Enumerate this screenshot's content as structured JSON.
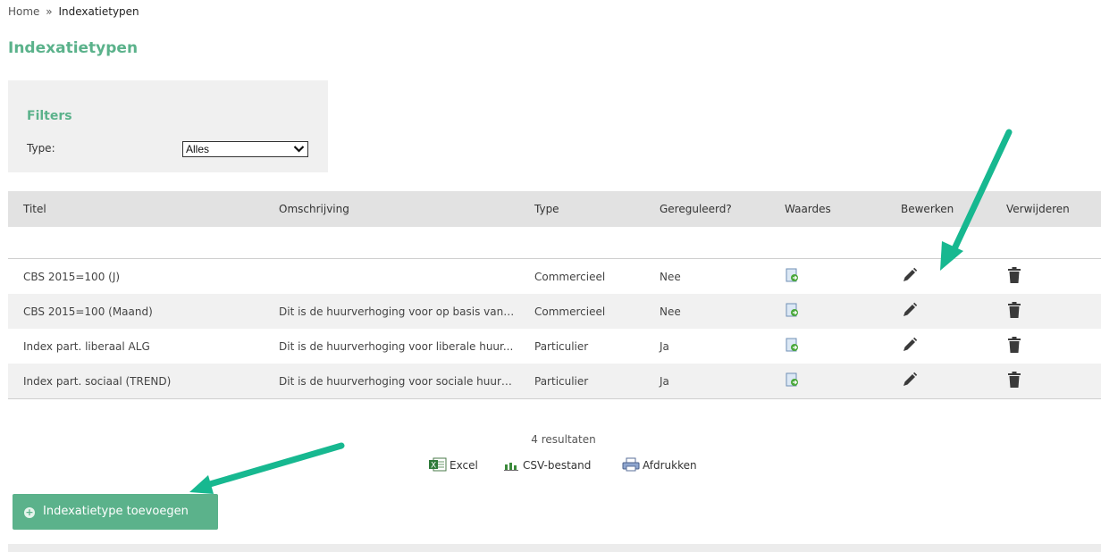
{
  "breadcrumb": {
    "home": "Home",
    "separator": "»",
    "current": "Indexatietypen"
  },
  "page_title": "Indexatietypen",
  "filters": {
    "title": "Filters",
    "type_label": "Type:",
    "type_value": "Alles"
  },
  "table": {
    "headers": {
      "titel": "Titel",
      "omschrijving": "Omschrijving",
      "type": "Type",
      "gereguleerd": "Gereguleerd?",
      "waardes": "Waardes",
      "bewerken": "Bewerken",
      "verwijderen": "Verwijderen"
    },
    "rows": [
      {
        "titel": "CBS 2015=100 (J)",
        "omschrijving": "",
        "type": "Commercieel",
        "gereguleerd": "Nee"
      },
      {
        "titel": "CBS 2015=100 (Maand)",
        "omschrijving": "Dit is de huurverhoging voor op basis van ...",
        "type": "Commercieel",
        "gereguleerd": "Nee"
      },
      {
        "titel": "Index part. liberaal ALG",
        "omschrijving": "Dit is de huurverhoging voor liberale huur...",
        "type": "Particulier",
        "gereguleerd": "Ja"
      },
      {
        "titel": "Index part. sociaal (TREND)",
        "omschrijving": "Dit is de huurverhoging voor sociale huurw...",
        "type": "Particulier",
        "gereguleerd": "Ja"
      }
    ]
  },
  "results_text": "4 resultaten",
  "exports": {
    "excel": "Excel",
    "csv": "CSV-bestand",
    "print": "Afdrukken"
  },
  "add_button": "Indexatietype toevoegen",
  "colors": {
    "accent": "#5bb28b",
    "annotation_arrow": "#17b890"
  },
  "icons": [
    "values-icon",
    "pencil-icon",
    "trash-icon",
    "excel-icon",
    "csv-icon",
    "printer-icon",
    "plus-circle-icon"
  ]
}
